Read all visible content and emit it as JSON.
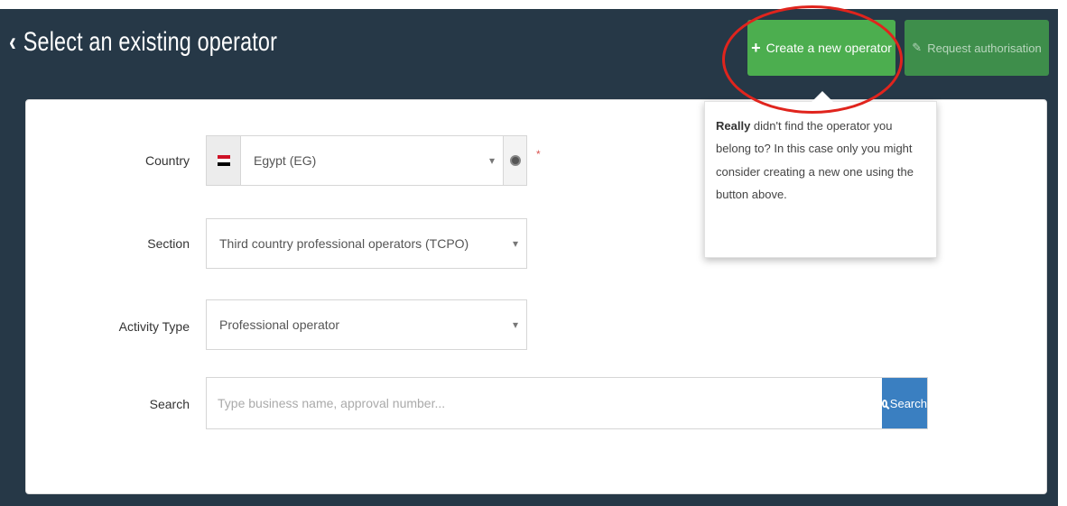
{
  "header": {
    "title": "Select an existing operator",
    "back_icon": "chevron-left-icon",
    "create_button": "Create a new operator",
    "request_button": "Request authorisation"
  },
  "tooltip": {
    "bold": "Really",
    "text": " didn't find the operator you belong to? In this case only you might consider creating a new one using the button above."
  },
  "form": {
    "country_label": "Country",
    "country_value": "Egypt (EG)",
    "section_label": "Section",
    "section_value": "Third country professional operators (TCPO)",
    "activity_label": "Activity Type",
    "activity_value": "Professional operator",
    "search_label": "Search",
    "search_placeholder": "Type business name, approval number...",
    "search_button": "Search",
    "required_marker": "*"
  },
  "colors": {
    "header_bg": "#263847",
    "create_btn": "#4cae4f",
    "request_btn": "#3e8e4b",
    "search_btn": "#3a7fc1",
    "annotation": "#e0241d"
  }
}
